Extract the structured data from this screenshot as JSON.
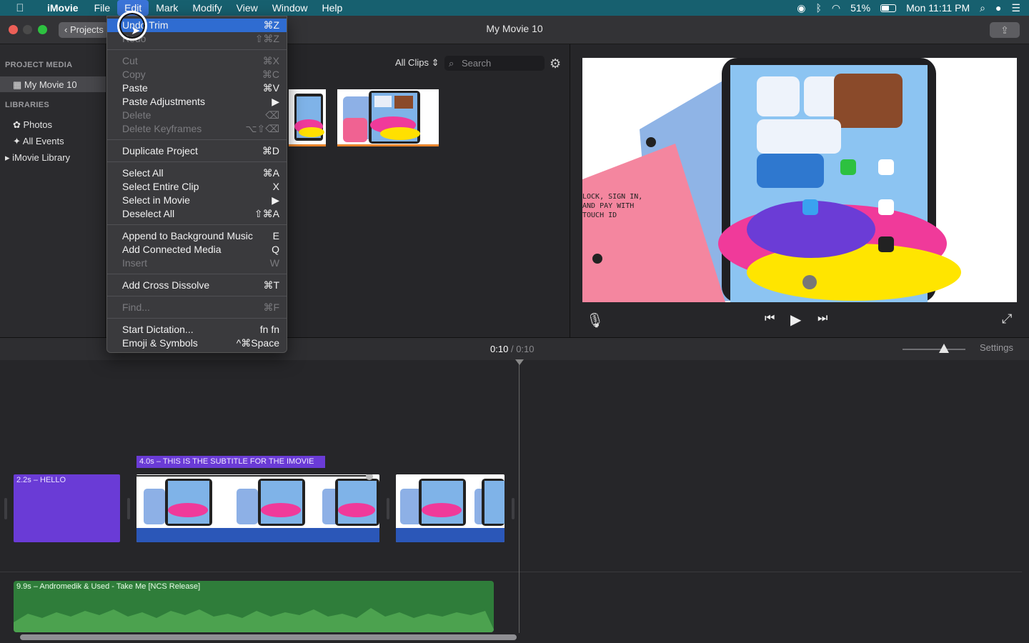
{
  "menubar": {
    "app_name": "iMovie",
    "items": [
      "File",
      "Edit",
      "Mark",
      "Modify",
      "View",
      "Window",
      "Help"
    ],
    "active_item": "Edit",
    "battery": "51%",
    "clock": "Mon 11:11 PM"
  },
  "window": {
    "title": "My Movie 10",
    "back_button": "Projects"
  },
  "sidebar": {
    "project_media_heading": "PROJECT MEDIA",
    "project_item": "My Movie 10",
    "libraries_heading": "LIBRARIES",
    "photos": "Photos",
    "all_events": "All Events",
    "library": "iMovie Library"
  },
  "browser": {
    "clip_filter": "All Clips",
    "search_placeholder": "Search"
  },
  "video_caption": [
    "LOCK, SIGN IN,",
    "AND PAY WITH",
    "TOUCH ID"
  ],
  "timeline": {
    "current_time": "0:10",
    "separator": "/",
    "total_time": "0:10",
    "settings": "Settings",
    "title_clip": "2.2s – HELLO",
    "subtitle_clip": "4.0s – THIS IS THE SUBTITLE FOR THE IMOVIE",
    "music_clip": "9.9s – Andromedik & Used - Take Me [NCS Release]"
  },
  "edit_menu": {
    "items": [
      {
        "label": "Undo Trim",
        "shortcut": "⌘Z",
        "state": "highlight"
      },
      {
        "label": "Redo",
        "shortcut": "⇧⌘Z",
        "state": "disabled"
      },
      {
        "label": "Cut",
        "shortcut": "⌘X",
        "state": "disabled"
      },
      {
        "label": "Copy",
        "shortcut": "⌘C",
        "state": "disabled"
      },
      {
        "label": "Paste",
        "shortcut": "⌘V",
        "state": "enabled"
      },
      {
        "label": "Paste Adjustments",
        "shortcut": "▶",
        "state": "enabled"
      },
      {
        "label": "Delete",
        "shortcut": "⌫",
        "state": "disabled"
      },
      {
        "label": "Delete Keyframes",
        "shortcut": "⌥⇧⌫",
        "state": "disabled"
      },
      {
        "label": "Duplicate Project",
        "shortcut": "⌘D",
        "state": "enabled"
      },
      {
        "label": "Select All",
        "shortcut": "⌘A",
        "state": "enabled"
      },
      {
        "label": "Select Entire Clip",
        "shortcut": "X",
        "state": "enabled"
      },
      {
        "label": "Select in Movie",
        "shortcut": "▶",
        "state": "enabled"
      },
      {
        "label": "Deselect All",
        "shortcut": "⇧⌘A",
        "state": "enabled"
      },
      {
        "label": "Append to Background Music",
        "shortcut": "E",
        "state": "enabled"
      },
      {
        "label": "Add Connected Media",
        "shortcut": "Q",
        "state": "enabled"
      },
      {
        "label": "Insert",
        "shortcut": "W",
        "state": "disabled"
      },
      {
        "label": "Add Cross Dissolve",
        "shortcut": "⌘T",
        "state": "enabled"
      },
      {
        "label": "Find...",
        "shortcut": "⌘F",
        "state": "disabled"
      },
      {
        "label": "Start Dictation...",
        "shortcut": "fn fn",
        "state": "enabled"
      },
      {
        "label": "Emoji & Symbols",
        "shortcut": "^⌘Space",
        "state": "enabled"
      }
    ]
  },
  "colors": {
    "menubar": "#17606f",
    "highlight": "#2f6cd1",
    "title_clip": "#6a3bd6",
    "music_clip": "#2f7d3a",
    "traffic_red": "#ec5f57",
    "traffic_yellow": "#4a4a4a",
    "traffic_green": "#2dc140"
  }
}
